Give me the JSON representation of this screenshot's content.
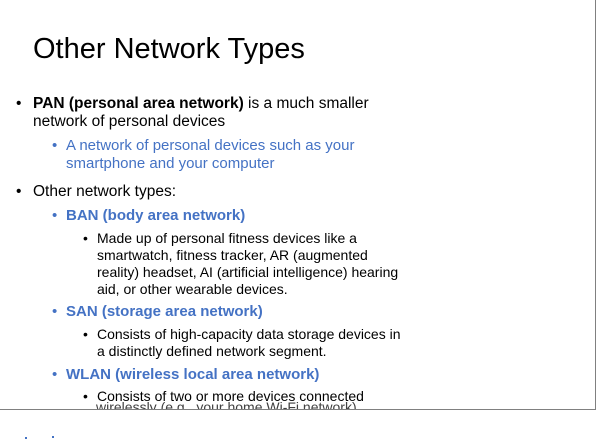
{
  "slide": {
    "title": "Other Network Types",
    "bullet_glyph": "•",
    "pan": {
      "term": "PAN (personal area network)",
      "rest_line1": " is a much smaller",
      "line2": "network of personal devices"
    },
    "pan_sub": {
      "line1": "A network of personal devices such as your",
      "line2": "smartphone and your computer"
    },
    "other_types": "Other network types:",
    "ban": {
      "heading": "BAN (body area network)",
      "desc_lines": [
        "Made up of personal fitness devices like a",
        "smartwatch, fitness tracker, AR (augmented",
        "reality) headset, AI (artificial intelligence) hearing",
        "aid, or other wearable devices."
      ]
    },
    "san": {
      "heading": "SAN (storage area network)",
      "desc_lines": [
        "Consists of high-capacity data storage devices in",
        "a distinctly defined network segment."
      ]
    },
    "wlan": {
      "heading": "WLAN (wireless local area network)",
      "desc_lines": [
        "Consists of two or more devices connected",
        "wirelessly (e.g., your home Wi-Fi network)"
      ]
    }
  }
}
